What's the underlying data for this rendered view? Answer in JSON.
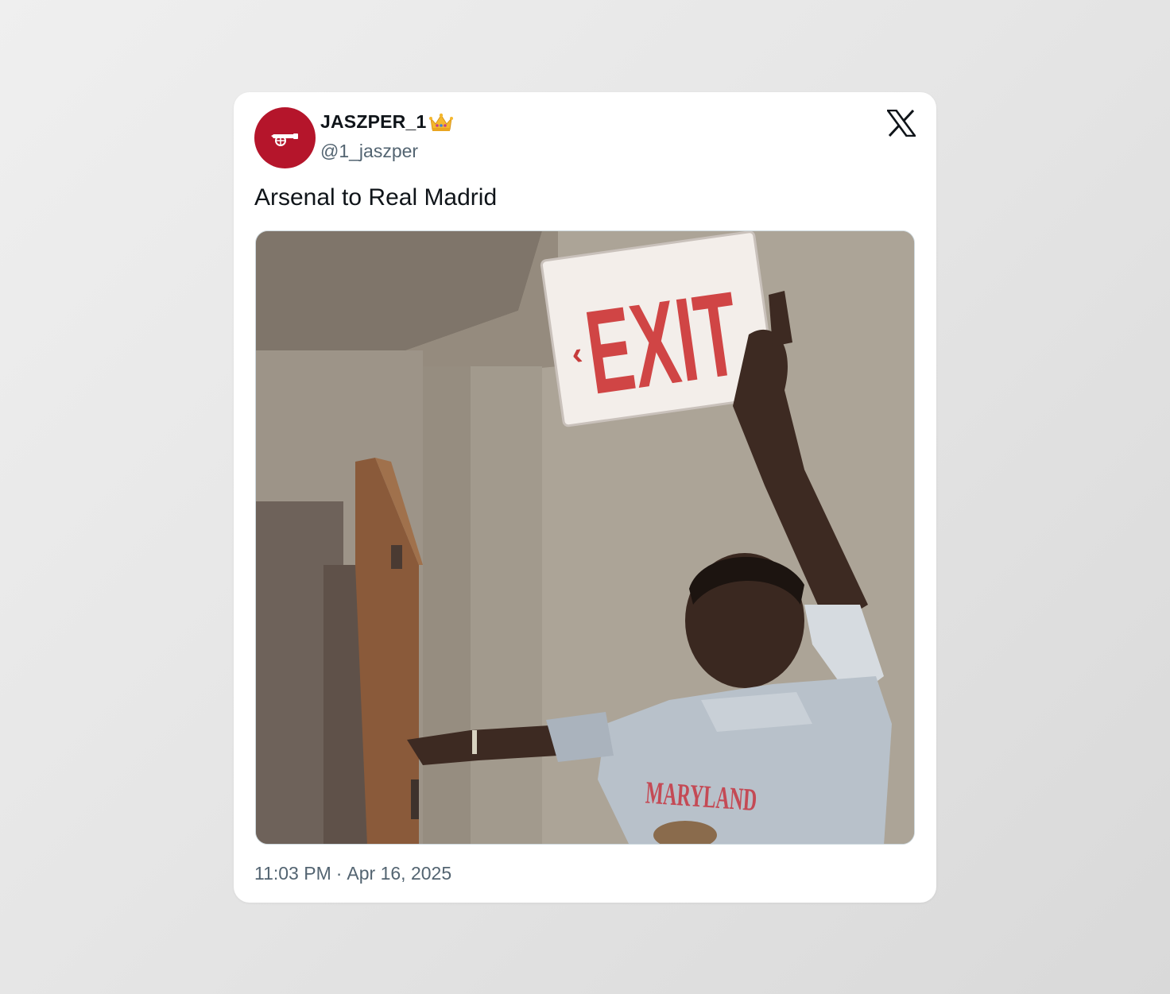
{
  "tweet": {
    "author": {
      "display_name": "JASZPER_1",
      "badge_icon": "crown-emoji",
      "handle": "@1_jaszper",
      "avatar_icon": "arsenal-cannon-icon",
      "avatar_color": "#b5152b"
    },
    "text": "Arsenal to Real Madrid",
    "media": {
      "description_icon": "meme-photo",
      "sign_text": "EXIT",
      "sign_arrow": "‹",
      "shirt_text": "MARYLAND"
    },
    "time": "11:03 PM",
    "separator": "·",
    "date": "Apr 16, 2025"
  },
  "brand": {
    "logo_icon": "x-logo-icon"
  }
}
